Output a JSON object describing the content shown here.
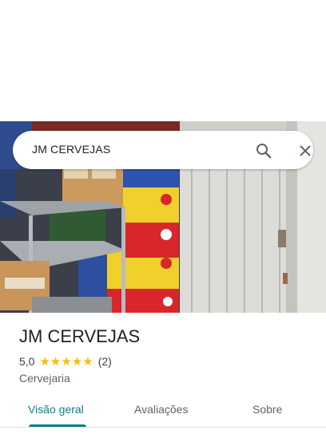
{
  "search": {
    "query": "JM CERVEJAS"
  },
  "icons": {
    "search": "search-icon",
    "close": "close-icon"
  },
  "place": {
    "name": "JM CERVEJAS",
    "rating": "5,0",
    "stars": 5,
    "review_count": "(2)",
    "category": "Cervejaria"
  },
  "tabs": [
    {
      "label": "Visão geral",
      "active": true
    },
    {
      "label": "Avaliações",
      "active": false
    },
    {
      "label": "Sobre",
      "active": false
    }
  ],
  "colors": {
    "accent": "#0e7c86",
    "star": "#fbbc04",
    "text": "#202124"
  }
}
